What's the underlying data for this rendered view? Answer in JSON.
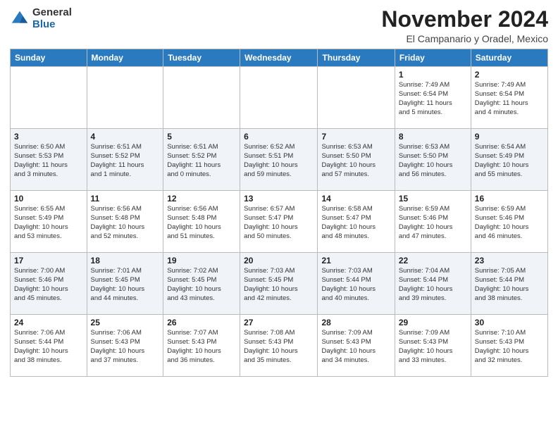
{
  "header": {
    "logo": {
      "general": "General",
      "blue": "Blue"
    },
    "month": "November 2024",
    "location": "El Campanario y Oradel, Mexico"
  },
  "calendar": {
    "weekdays": [
      "Sunday",
      "Monday",
      "Tuesday",
      "Wednesday",
      "Thursday",
      "Friday",
      "Saturday"
    ],
    "weeks": [
      [
        {
          "day": "",
          "info": ""
        },
        {
          "day": "",
          "info": ""
        },
        {
          "day": "",
          "info": ""
        },
        {
          "day": "",
          "info": ""
        },
        {
          "day": "",
          "info": ""
        },
        {
          "day": "1",
          "info": "Sunrise: 7:49 AM\nSunset: 6:54 PM\nDaylight: 11 hours\nand 5 minutes."
        },
        {
          "day": "2",
          "info": "Sunrise: 7:49 AM\nSunset: 6:54 PM\nDaylight: 11 hours\nand 4 minutes."
        }
      ],
      [
        {
          "day": "3",
          "info": "Sunrise: 6:50 AM\nSunset: 5:53 PM\nDaylight: 11 hours\nand 3 minutes."
        },
        {
          "day": "4",
          "info": "Sunrise: 6:51 AM\nSunset: 5:52 PM\nDaylight: 11 hours\nand 1 minute."
        },
        {
          "day": "5",
          "info": "Sunrise: 6:51 AM\nSunset: 5:52 PM\nDaylight: 11 hours\nand 0 minutes."
        },
        {
          "day": "6",
          "info": "Sunrise: 6:52 AM\nSunset: 5:51 PM\nDaylight: 10 hours\nand 59 minutes."
        },
        {
          "day": "7",
          "info": "Sunrise: 6:53 AM\nSunset: 5:50 PM\nDaylight: 10 hours\nand 57 minutes."
        },
        {
          "day": "8",
          "info": "Sunrise: 6:53 AM\nSunset: 5:50 PM\nDaylight: 10 hours\nand 56 minutes."
        },
        {
          "day": "9",
          "info": "Sunrise: 6:54 AM\nSunset: 5:49 PM\nDaylight: 10 hours\nand 55 minutes."
        }
      ],
      [
        {
          "day": "10",
          "info": "Sunrise: 6:55 AM\nSunset: 5:49 PM\nDaylight: 10 hours\nand 53 minutes."
        },
        {
          "day": "11",
          "info": "Sunrise: 6:56 AM\nSunset: 5:48 PM\nDaylight: 10 hours\nand 52 minutes."
        },
        {
          "day": "12",
          "info": "Sunrise: 6:56 AM\nSunset: 5:48 PM\nDaylight: 10 hours\nand 51 minutes."
        },
        {
          "day": "13",
          "info": "Sunrise: 6:57 AM\nSunset: 5:47 PM\nDaylight: 10 hours\nand 50 minutes."
        },
        {
          "day": "14",
          "info": "Sunrise: 6:58 AM\nSunset: 5:47 PM\nDaylight: 10 hours\nand 48 minutes."
        },
        {
          "day": "15",
          "info": "Sunrise: 6:59 AM\nSunset: 5:46 PM\nDaylight: 10 hours\nand 47 minutes."
        },
        {
          "day": "16",
          "info": "Sunrise: 6:59 AM\nSunset: 5:46 PM\nDaylight: 10 hours\nand 46 minutes."
        }
      ],
      [
        {
          "day": "17",
          "info": "Sunrise: 7:00 AM\nSunset: 5:46 PM\nDaylight: 10 hours\nand 45 minutes."
        },
        {
          "day": "18",
          "info": "Sunrise: 7:01 AM\nSunset: 5:45 PM\nDaylight: 10 hours\nand 44 minutes."
        },
        {
          "day": "19",
          "info": "Sunrise: 7:02 AM\nSunset: 5:45 PM\nDaylight: 10 hours\nand 43 minutes."
        },
        {
          "day": "20",
          "info": "Sunrise: 7:03 AM\nSunset: 5:45 PM\nDaylight: 10 hours\nand 42 minutes."
        },
        {
          "day": "21",
          "info": "Sunrise: 7:03 AM\nSunset: 5:44 PM\nDaylight: 10 hours\nand 40 minutes."
        },
        {
          "day": "22",
          "info": "Sunrise: 7:04 AM\nSunset: 5:44 PM\nDaylight: 10 hours\nand 39 minutes."
        },
        {
          "day": "23",
          "info": "Sunrise: 7:05 AM\nSunset: 5:44 PM\nDaylight: 10 hours\nand 38 minutes."
        }
      ],
      [
        {
          "day": "24",
          "info": "Sunrise: 7:06 AM\nSunset: 5:44 PM\nDaylight: 10 hours\nand 38 minutes."
        },
        {
          "day": "25",
          "info": "Sunrise: 7:06 AM\nSunset: 5:43 PM\nDaylight: 10 hours\nand 37 minutes."
        },
        {
          "day": "26",
          "info": "Sunrise: 7:07 AM\nSunset: 5:43 PM\nDaylight: 10 hours\nand 36 minutes."
        },
        {
          "day": "27",
          "info": "Sunrise: 7:08 AM\nSunset: 5:43 PM\nDaylight: 10 hours\nand 35 minutes."
        },
        {
          "day": "28",
          "info": "Sunrise: 7:09 AM\nSunset: 5:43 PM\nDaylight: 10 hours\nand 34 minutes."
        },
        {
          "day": "29",
          "info": "Sunrise: 7:09 AM\nSunset: 5:43 PM\nDaylight: 10 hours\nand 33 minutes."
        },
        {
          "day": "30",
          "info": "Sunrise: 7:10 AM\nSunset: 5:43 PM\nDaylight: 10 hours\nand 32 minutes."
        }
      ]
    ]
  }
}
